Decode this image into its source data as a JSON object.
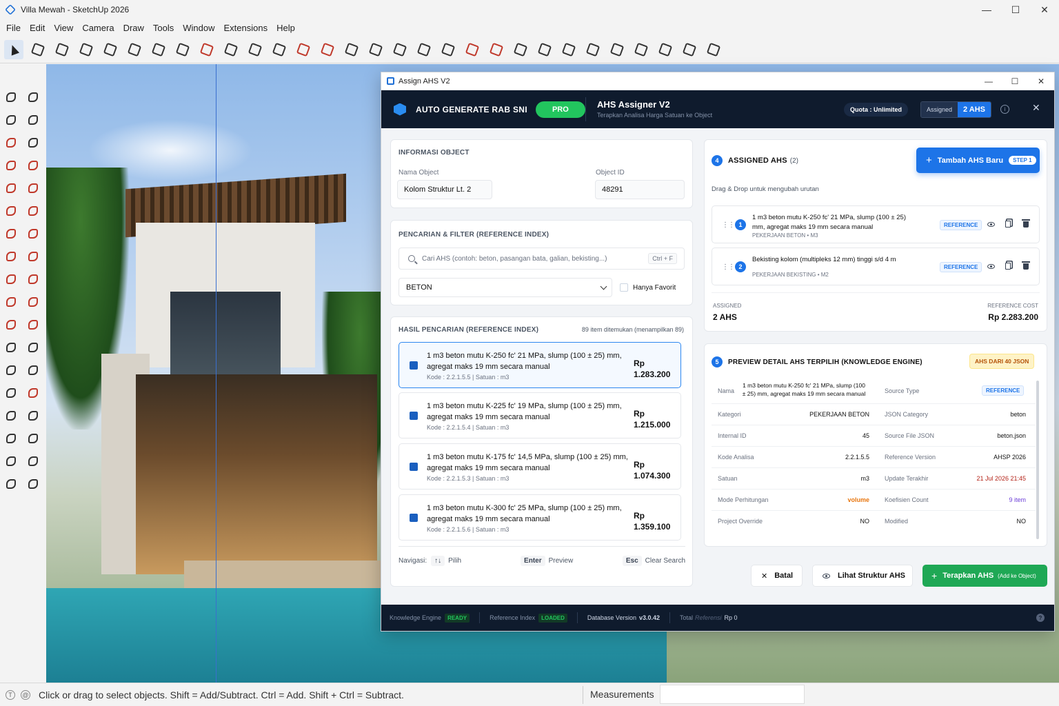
{
  "window": {
    "title": "Villa Mewah - SketchUp 2026"
  },
  "menu": [
    "File",
    "Edit",
    "View",
    "Camera",
    "Draw",
    "Tools",
    "Window",
    "Extensions",
    "Help"
  ],
  "dialog": {
    "title": "Assign AHS V2",
    "brand": "AUTO GENERATE RAB SNI",
    "pro_label": "PRO",
    "app_title": "AHS Assigner V2",
    "app_subtitle": "Terapkan Analisa Harga Satuan ke Object",
    "quota": "Quota : Unlimited",
    "assigned_label": "Assigned",
    "assigned_value": "2 AHS",
    "info_icon": "i",
    "close_icon": "✕"
  },
  "object_info": {
    "heading": "INFORMASI OBJECT",
    "name_label": "Nama Object",
    "name_value": "Kolom Struktur Lt. 2",
    "id_label": "Object ID",
    "id_value": "48291"
  },
  "search": {
    "heading": "PENCARIAN & FILTER (REFERENCE INDEX)",
    "placeholder": "Cari AHS (contoh: beton, pasangan bata, galian, bekisting...)",
    "shortcut": "Ctrl + F",
    "category": "BETON",
    "favorite_label": "Hanya Favorit"
  },
  "results": {
    "heading": "HASIL PENCARIAN (REFERENCE INDEX)",
    "count": "89 item ditemukan (menampilkan 89)",
    "items": [
      {
        "line1": "1 m3 beton mutu K-250 fc' 21 MPa, slump (100 ± 25) mm,",
        "line2": "agregat maks 19 mm secara manual",
        "code": "Kode : 2.2.1.5.5 | Satuan : m3",
        "rp": "Rp",
        "price": "1.283.200"
      },
      {
        "line1": "1 m3 beton mutu K-225 fc' 19 MPa, slump (100 ± 25) mm,",
        "line2": "agregat maks 19 mm secara manual",
        "code": "Kode : 2.2.1.5.4 | Satuan : m3",
        "rp": "Rp",
        "price": "1.215.000"
      },
      {
        "line1": "1 m3 beton mutu K-175 fc' 14,5 MPa, slump (100 ± 25) mm,",
        "line2": "agregat maks 19 mm secara manual",
        "code": "Kode : 2.2.1.5.3 | Satuan : m3",
        "rp": "Rp",
        "price": "1.074.300"
      },
      {
        "line1": "1 m3 beton mutu K-300 fc' 25 MPa, slump (100 ± 25) mm,",
        "line2": "agregat maks 19 mm secara manual",
        "code": "Kode : 2.2.1.5.6 | Satuan : m3",
        "rp": "Rp",
        "price": "1.359.100"
      }
    ],
    "nav_label": "Navigasi:",
    "nav_arrows": "↑↓",
    "nav_pick": "Pilih",
    "nav_enter": "Enter",
    "nav_preview": "Preview",
    "nav_esc": "Esc",
    "nav_clear": "Clear Search"
  },
  "assigned": {
    "step": "4",
    "heading": "ASSIGNED AHS",
    "count": "(2)",
    "add_label": "Tambah AHS Baru",
    "add_step": "STEP 1",
    "drag_hint": "Drag & Drop untuk mengubah urutan",
    "items": [
      {
        "num": "1",
        "line1": "1 m3 beton mutu K-250 fc' 21 MPa, slump (100 ± 25)",
        "line2": "mm, agregat maks 19 mm secara manual",
        "sub": "PEKERJAAN BETON • M3",
        "badge": "REFERENCE"
      },
      {
        "num": "2",
        "line1": "Bekisting kolom (multipleks 12 mm) tinggi s/d 4 m",
        "line2": "",
        "sub": "PEKERJAAN BEKISTING • M2",
        "badge": "REFERENCE"
      }
    ],
    "summary_label": "ASSIGNED",
    "summary_value": "2 AHS",
    "cost_label": "REFERENCE COST",
    "cost_value": "Rp 2.283.200"
  },
  "preview": {
    "step": "5",
    "heading": "PREVIEW DETAIL AHS TERPILIH (KNOWLEDGE ENGINE)",
    "badge": "AHS DARI 40 JSON",
    "name_label": "Nama",
    "name_line1": "1 m3 beton mutu K-250 fc' 21 MPa, slump (100",
    "name_line2": "± 25) mm, agregat maks 19 mm secara manual",
    "source_type_label": "Source Type",
    "source_type_value": "REFERENCE",
    "rows": [
      {
        "k1": "Kategori",
        "v1": "PEKERJAAN BETON",
        "k2": "JSON Category",
        "v2": "beton"
      },
      {
        "k1": "Internal ID",
        "v1": "45",
        "k2": "Source File JSON",
        "v2": "beton.json"
      },
      {
        "k1": "Kode Analisa",
        "v1": "2.2.1.5.5",
        "k2": "Reference Version",
        "v2": "AHSP 2026"
      },
      {
        "k1": "Satuan",
        "v1": "m3",
        "k2": "Update Terakhir",
        "v2": "21 Jul 2026 21:45"
      },
      {
        "k1": "Mode Perhitungan",
        "v1": "volume",
        "k2": "Koefisien Count",
        "v2": "9 item"
      },
      {
        "k1": "Project Override",
        "v1": "NO",
        "k2": "Modified",
        "v2": "NO"
      }
    ],
    "colors": {
      "volume": "#e8760f",
      "date": "#b42318",
      "count": "#6d3fd8"
    }
  },
  "actions": {
    "cancel": "Batal",
    "view_structure": "Lihat Struktur AHS",
    "apply": "Terapkan AHS",
    "apply_sub": "(Add ke Object)"
  },
  "footer": {
    "ke_label": "Knowledge Engine",
    "ke_status": "READY",
    "ri_label": "Reference Index",
    "ri_status": "LOADED",
    "db_label": "Database Version",
    "db_value": "v3.0.42",
    "total_label": "Total",
    "total_italic": "Referensi",
    "total_value": "Rp 0",
    "help": "?"
  },
  "status": {
    "hint": "Click or drag to select objects. Shift = Add/Subtract. Ctrl = Add. Shift + Ctrl = Subtract.",
    "measurements": "Measurements"
  },
  "accent_colors": {
    "blue": "#1d74e8",
    "green": "#1fa855",
    "navy": "#0f1b2d"
  }
}
